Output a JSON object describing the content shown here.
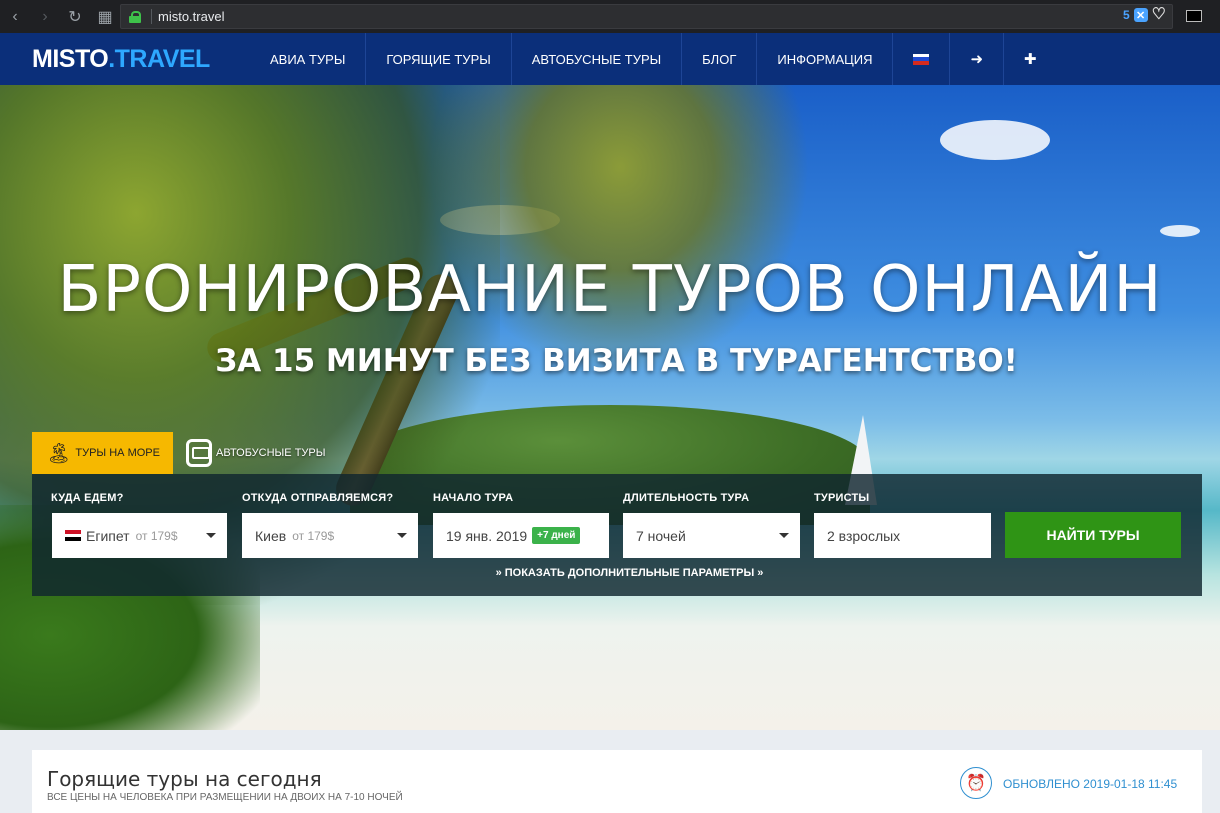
{
  "browser": {
    "url": "misto.travel",
    "badge_count": "5",
    "back_icon": "‹",
    "forward_icon": "›",
    "reload_icon": "↻",
    "grid_icon": "▦"
  },
  "header": {
    "logo_main": "MISTO",
    "logo_tail": ".TRAVEL",
    "nav": [
      {
        "label": "АВИА ТУРЫ"
      },
      {
        "label": "ГОРЯЩИЕ ТУРЫ"
      },
      {
        "label": "АВТОБУСНЫЕ ТУРЫ"
      },
      {
        "label": "БЛОГ"
      },
      {
        "label": "ИНФОРМАЦИЯ"
      }
    ],
    "login_icon": "➜",
    "register_icon": "✚"
  },
  "hero": {
    "title": "БРОНИРОВАНИЕ ТУРОВ ОНЛАЙН",
    "subtitle": "ЗА 15 МИНУТ БЕЗ ВИЗИТА В ТУРАГЕНТСТВО!"
  },
  "tabs": {
    "sea": "ТУРЫ НА МОРЕ",
    "bus": "АВТОБУСНЫЕ ТУРЫ"
  },
  "search": {
    "destination_label": "КУДА ЕДЕМ?",
    "destination_value": "Египет",
    "destination_price": "от 179$",
    "departure_label": "ОТКУДА ОТПРАВЛЯЕМСЯ?",
    "departure_value": "Киев",
    "departure_price": "от 179$",
    "start_label": "НАЧАЛО ТУРА",
    "start_value": "19 янв. 2019",
    "start_badge": "+7 дней",
    "duration_label": "ДЛИТЕЛЬНОСТЬ ТУРА",
    "duration_value": "7 ночей",
    "tourists_label": "ТУРИСТЫ",
    "tourists_value": "2 взрослых",
    "button": "НАЙТИ ТУРЫ",
    "more": "» ПОКАЗАТЬ ДОПОЛНИТЕЛЬНЫЕ ПАРАМЕТРЫ »"
  },
  "hot": {
    "title": "Горящие туры на сегодня",
    "subtitle": "ВСЕ ЦЕНЫ НА ЧЕЛОВЕКА ПРИ РАЗМЕЩЕНИИ НА ДВОИХ НА 7-10 НОЧЕЙ",
    "updated": "ОБНОВЛЕНО 2019-01-18 11:45"
  },
  "colors": {
    "header_bg": "#0b2f7a",
    "accent_blue": "#2ea8ff",
    "tab_active": "#f6b800",
    "search_button": "#2f9415",
    "badge_green": "#3bb24a"
  }
}
